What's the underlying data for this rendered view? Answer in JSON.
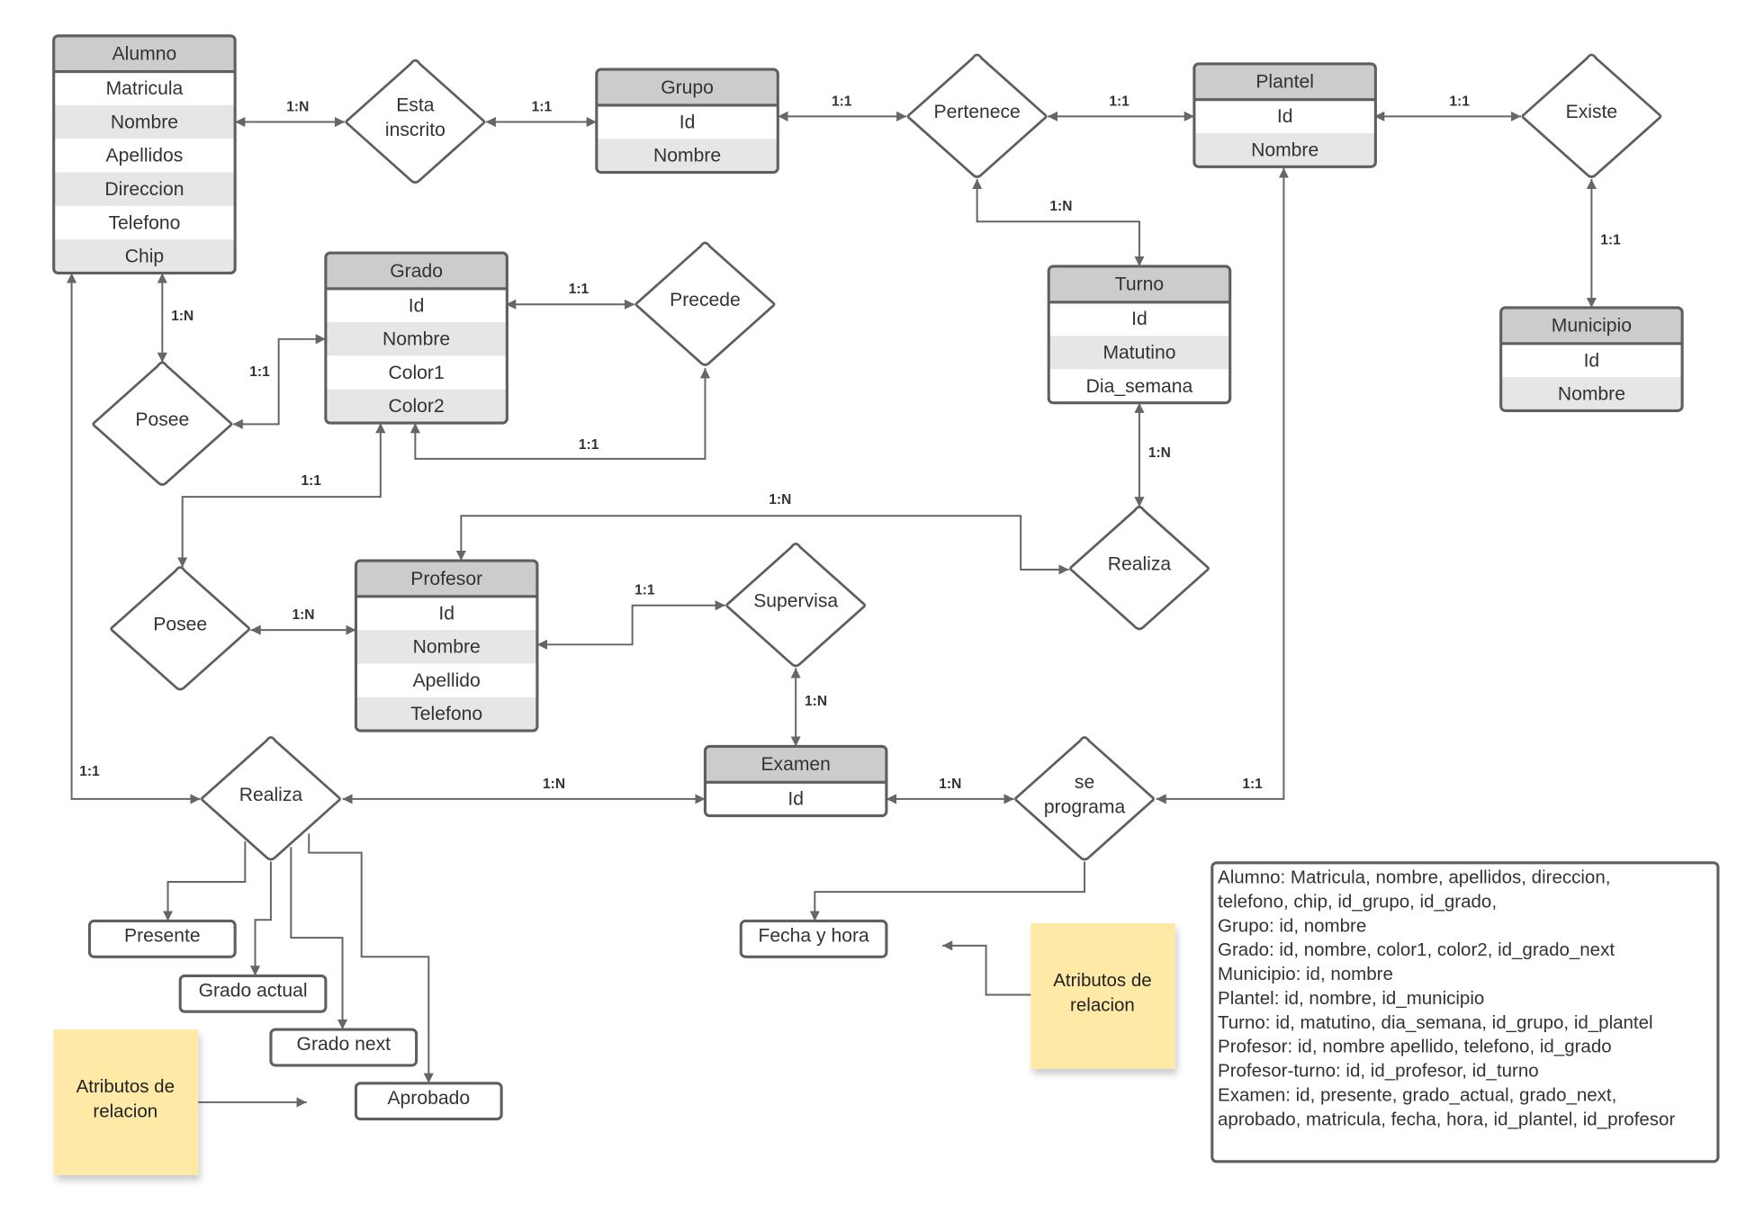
{
  "entities": {
    "alumno": {
      "title": "Alumno",
      "fields": [
        "Matricula",
        "Nombre",
        "Apellidos",
        "Direccion",
        "Telefono",
        "Chip"
      ]
    },
    "grupo": {
      "title": "Grupo",
      "fields": [
        "Id",
        "Nombre"
      ]
    },
    "plantel": {
      "title": "Plantel",
      "fields": [
        "Id",
        "Nombre"
      ]
    },
    "grado": {
      "title": "Grado",
      "fields": [
        "Id",
        "Nombre",
        "Color1",
        "Color2"
      ]
    },
    "turno": {
      "title": "Turno",
      "fields": [
        "Id",
        "Matutino",
        "Dia_semana"
      ]
    },
    "municipio": {
      "title": "Municipio",
      "fields": [
        "Id",
        "Nombre"
      ]
    },
    "profesor": {
      "title": "Profesor",
      "fields": [
        "Id",
        "Nombre",
        "Apellido",
        "Telefono"
      ]
    },
    "examen": {
      "title": "Examen",
      "fields": [
        "Id"
      ]
    }
  },
  "relationships": {
    "esta_inscrito": [
      "Esta",
      "inscrito"
    ],
    "pertenece": [
      "Pertenece"
    ],
    "existe": [
      "Existe"
    ],
    "precede": [
      "Precede"
    ],
    "posee1": [
      "Posee"
    ],
    "posee2": [
      "Posee"
    ],
    "supervisa": [
      "Supervisa"
    ],
    "realiza_turno": [
      "Realiza"
    ],
    "realiza_examen": [
      "Realiza"
    ],
    "se_programa": [
      "se",
      "programa"
    ]
  },
  "attributes": {
    "presente": "Presente",
    "grado_actual": "Grado actual",
    "grado_next": "Grado next",
    "aprobado": "Aprobado",
    "fecha_hora": "Fecha y hora"
  },
  "cardinalities": {
    "alumno_esta": "1:N",
    "esta_grupo": "1:1",
    "grupo_pertenece": "1:1",
    "pertenece_plantel": "1:1",
    "plantel_existe": "1:1",
    "existe_municipio": "1:1",
    "pertenece_turno": "1:N",
    "alumno_posee": "1:N",
    "posee_grado": "1:1",
    "grado_precede": "1:1",
    "precede_grado": "1:1",
    "grado_posee2": "1:1",
    "posee2_profesor": "1:N",
    "profesor_supervisa": "1:1",
    "supervisa_examen": "1:N",
    "profesor_realiza": "1:N",
    "turno_realiza": "1:N",
    "alumno_realiza": "1:1",
    "realiza_examen": "1:N",
    "examen_programa": "1:N",
    "plantel_programa": "1:1"
  },
  "sticky_notes": [
    "Atributos de relacion",
    "Atributos de relacion"
  ],
  "schema_notes": [
    "Alumno: Matricula, nombre, apellidos, direccion,",
    "telefono, chip, id_grupo, id_grado,",
    "Grupo: id, nombre",
    "Grado: id, nombre, color1, color2, id_grado_next",
    "Municipio: id, nombre",
    "Plantel: id, nombre, id_municipio",
    "Turno: id, matutino, dia_semana, id_grupo, id_plantel",
    "Profesor: id, nombre apellido, telefono, id_grado",
    "Profesor-turno: id, id_profesor, id_turno",
    "Examen: id, presente, grado_actual, grado_next,",
    "aprobado, matricula, fecha, hora, id_plantel, id_profesor"
  ],
  "colors": {
    "header": "#cccccc",
    "alt_row": "#e6e6e6",
    "sticky": "#ffe9a6",
    "stroke": "#5f5f5f"
  }
}
